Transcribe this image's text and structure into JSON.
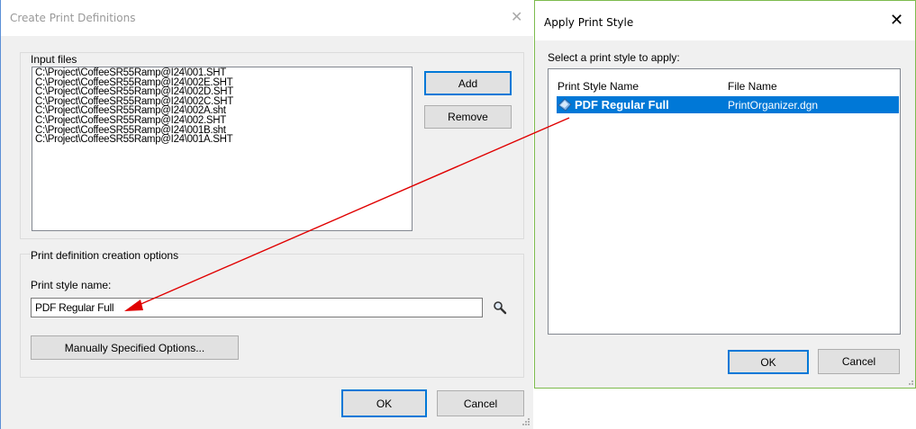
{
  "create_dialog": {
    "title": "Create Print Definitions",
    "close_glyph": "✕",
    "input_files": {
      "label": "Input files",
      "items": [
        "C:\\Project\\CoffeeSR55Ramp@I24\\001.SHT",
        "C:\\Project\\CoffeeSR55Ramp@I24\\002E.SHT",
        "C:\\Project\\CoffeeSR55Ramp@I24\\002D.SHT",
        "C:\\Project\\CoffeeSR55Ramp@I24\\002C.SHT",
        "C:\\Project\\CoffeeSR55Ramp@I24\\002A.sht",
        "C:\\Project\\CoffeeSR55Ramp@I24\\002.SHT",
        "C:\\Project\\CoffeeSR55Ramp@I24\\001B.sht",
        "C:\\Project\\CoffeeSR55Ramp@I24\\001A.SHT"
      ],
      "add_label": "Add",
      "remove_label": "Remove"
    },
    "options": {
      "label": "Print definition creation options",
      "style_name_label": "Print style name:",
      "style_name_value": "PDF Regular Full",
      "manual_label": "Manually Specified Options..."
    },
    "ok_label": "OK",
    "cancel_label": "Cancel"
  },
  "apply_dialog": {
    "title": "Apply Print Style",
    "close_glyph": "✕",
    "instruction": "Select a print style to apply:",
    "columns": [
      "Print Style Name",
      "File Name"
    ],
    "rows": [
      {
        "style_name": "PDF Regular Full",
        "file_name": "PrintOrganizer.dgn",
        "selected": true
      }
    ],
    "ok_label": "OK",
    "cancel_label": "Cancel"
  },
  "annotation": {
    "arrow_color": "#e00000"
  }
}
